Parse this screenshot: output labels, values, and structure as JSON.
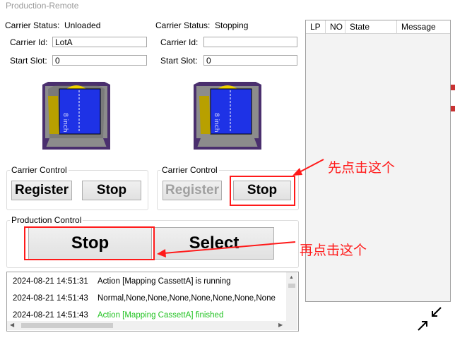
{
  "window": {
    "title": "Production-Remote"
  },
  "carrier_left": {
    "status_label": "Carrier Status:",
    "status_value": "Unloaded",
    "id_label": "Carrier Id:",
    "id_value": "LotA",
    "slot_label": "Start Slot:",
    "slot_value": "0",
    "cassette_text": "8 inch"
  },
  "carrier_right": {
    "status_label": "Carrier Status:",
    "status_value": "Stopping",
    "id_label": "Carrier Id:",
    "id_value": "",
    "slot_label": "Start Slot:",
    "slot_value": "0",
    "cassette_text": "8 inch"
  },
  "carrier_control_left": {
    "title": "Carrier Control",
    "register_label": "Register",
    "stop_label": "Stop"
  },
  "carrier_control_right": {
    "title": "Carrier Control",
    "register_label": "Register",
    "stop_label": "Stop"
  },
  "production_control": {
    "title": "Production Control",
    "stop_label": "Stop",
    "select_label": "Select"
  },
  "log": [
    {
      "time": "2024-08-21 14:51:31",
      "message": "Action [Mapping CassettA] is running",
      "color": "#000000"
    },
    {
      "time": "2024-08-21 14:51:43",
      "message": "Normal,None,None,None,None,None,None,None",
      "color": "#000000"
    },
    {
      "time": "2024-08-21 14:51:43",
      "message": "Action [Mapping CassettA] finished",
      "color": "#22c322"
    }
  ],
  "grid": {
    "columns": [
      "LP",
      "NO",
      "State",
      "Message"
    ]
  },
  "annotations": {
    "first": "先点击这个",
    "second": "再点击这个"
  },
  "colors": {
    "annotation_red": "#ff1a1a",
    "cassette_blue": "#1e32e6",
    "cassette_yellow": "#f0d200",
    "cassette_gray": "#8c8c8c",
    "cassette_frame": "#4a2f6e"
  }
}
